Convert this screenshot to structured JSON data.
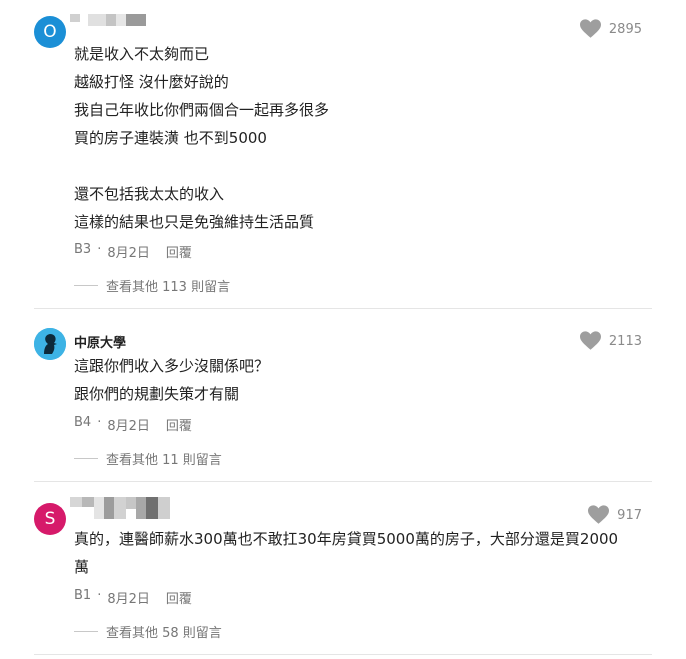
{
  "comments": [
    {
      "avatar_letter": "O",
      "avatar_color": "#1b8fd6",
      "likes": "2895",
      "lines": [
        "就是收入不太夠而已",
        "越級打怪 沒什麼好說的",
        "我自己年收比你們兩個合一起再多很多",
        "買的房子連裝潢 也不到5000",
        "",
        "還不包括我太太的收入",
        "這樣的結果也只是免強維持生活品質"
      ],
      "floor": "B3",
      "date": "8月2日",
      "reply": "回覆",
      "more": "查看其他 113 則留言"
    },
    {
      "author": "中原大學",
      "avatar_color": "#3db3e5",
      "likes": "2113",
      "lines": [
        "這跟你們收入多少沒關係吧？",
        "跟你們的規劃失策才有關"
      ],
      "floor": "B4",
      "date": "8月2日",
      "reply": "回覆",
      "more": "查看其他 11 則留言"
    },
    {
      "avatar_letter": "S",
      "avatar_color": "#d61a6a",
      "likes": "917",
      "lines": [
        "真的，連醫師薪水300萬也不敢扛30年房貸買5000萬的房子，大部分還是買2000",
        "萬"
      ],
      "floor": "B1",
      "date": "8月2日",
      "reply": "回覆",
      "more": "查看其他 58 則留言"
    }
  ],
  "dot": "·"
}
